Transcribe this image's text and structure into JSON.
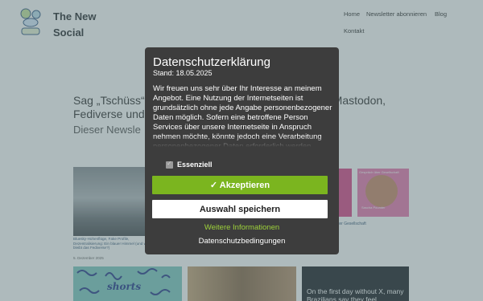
{
  "site": {
    "title_line1": "The New",
    "title_line2": "Social"
  },
  "nav": {
    "home": "Home",
    "newsletter": "Newsletter abonnieren",
    "blog": "Blog",
    "contact": "Kontakt"
  },
  "hero": {
    "headline_left": "Sag „Tschüss“",
    "headline_right": "zu Mastodon,",
    "headline_line2": "Fediverse und",
    "subhead": "Dieser Newsle"
  },
  "cards": {
    "cloud_caption": "Bluesky-Hohenflüge, Fake Profile, Dezentralisierung: Ein blauer Himmel (und wo bleibt das Fediverse?)",
    "cloud_date": "5. Dezember 2025",
    "pink_caption": "ter Gesellschaft",
    "pink_text": "Gespräch über Gesellschaft",
    "pink_name": "Sascha Pounder",
    "shorts_word": "shorts",
    "news_text": "On the first day without X, many Brazilians say they feel disconnected"
  },
  "consent": {
    "title": "Datenschutzerklärung",
    "date": "Stand: 18.05.2025",
    "body": "Wir freuen uns sehr über Ihr Interesse an meinem Angebot. Eine Nutzung der Internetseiten ist grundsätzlich ohne jede Angabe personenbezogener Daten möglich. Sofern eine betroffene Person Services über unsere Internetseite in Anspruch nehmen möchte, könnte jedoch eine Verarbeitung personenbezogener Daten erforderlich werden.",
    "essential_label": "Essenziell",
    "accept_label": "✓ Akzeptieren",
    "save_label": "Auswahl speichern",
    "more_info": "Weitere Informationen",
    "privacy_link": "Datenschutzbedingungen"
  },
  "colors": {
    "accent_green": "#7bb51f",
    "link_green": "#9ed23a",
    "dialog_bg": "#3d3d3d"
  }
}
